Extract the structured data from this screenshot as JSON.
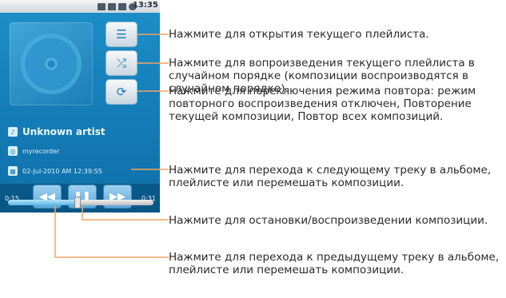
{
  "status_bar": {
    "time": "13:35"
  },
  "now_playing": {
    "artist": "Unknown artist",
    "album": "myrecorder",
    "date": "02-Jul-2010 AM 12:39:55",
    "time_elapsed": "0:15",
    "time_total": "0:31",
    "progress": 0.48
  },
  "icons": {
    "playlist": "list-icon",
    "shuffle": "shuffle-icon",
    "repeat": "repeat-icon",
    "prev": "rewind-icon",
    "pause": "pause-icon",
    "next": "fast-forward-icon"
  },
  "callouts": {
    "playlist": "Нажмите для открытия текущего плейлиста.",
    "shuffle": "Нажмите для вопроизведения текущего плейлиста в случайном порядке (композиции воспроизводятся в случайном порядке).",
    "repeat": "Нажмите для переключения режима повтора: режим повторного воспроизведения отключен, Повторение текущей композиции, Повтор всех композиций.",
    "next": "Нажмите для перехода к следующему треку в альбоме, плейлисте или перемешать композиции.",
    "pause": "Нажмите для остановки/воспроизведении композиции.",
    "prev": "Нажмите для перехода к предыдущему треку в альбоме, плейлисте или перемешать композиции."
  },
  "colors": {
    "accent": "#1680bb",
    "callout_line": "#f4a35f"
  }
}
